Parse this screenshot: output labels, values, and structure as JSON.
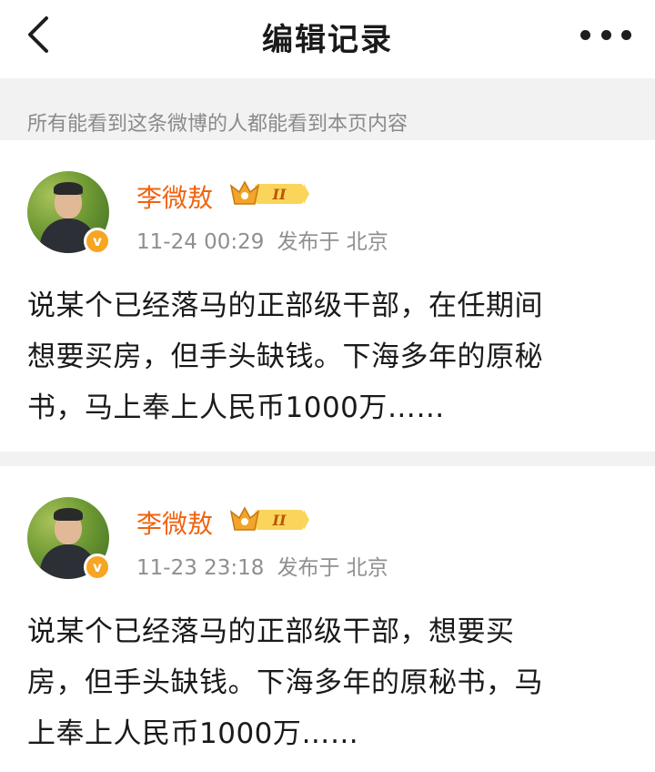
{
  "nav": {
    "title": "编辑记录"
  },
  "notice": "所有能看到这条微博的人都能看到本页内容",
  "records": [
    {
      "author": "李微敖",
      "level": "II",
      "time": "11-24 00:29",
      "location": "发布于 北京",
      "lines": [
        "说某个已经落马的正部级干部，在任期间",
        "想要买房，但手头缺钱。下海多年的原秘",
        "书，马上奉上人民币1000万……"
      ]
    },
    {
      "author": "李微敖",
      "level": "II",
      "time": "11-23 23:18",
      "location": "发布于 北京",
      "lines": [
        "说某个已经落马的正部级干部，想要买",
        "房，但手头缺钱。下海多年的原秘书，马",
        "上奉上人民币1000万……"
      ]
    }
  ],
  "colors": {
    "accent_name": "#f0630f",
    "badge": "#f6a623",
    "background_gray": "#f2f2f2"
  },
  "icons": {
    "back": "chevron-left-icon",
    "more": "more-dots-icon",
    "verified": "verified-v-icon",
    "crown": "crown-level-icon"
  },
  "verified_glyph": "v"
}
